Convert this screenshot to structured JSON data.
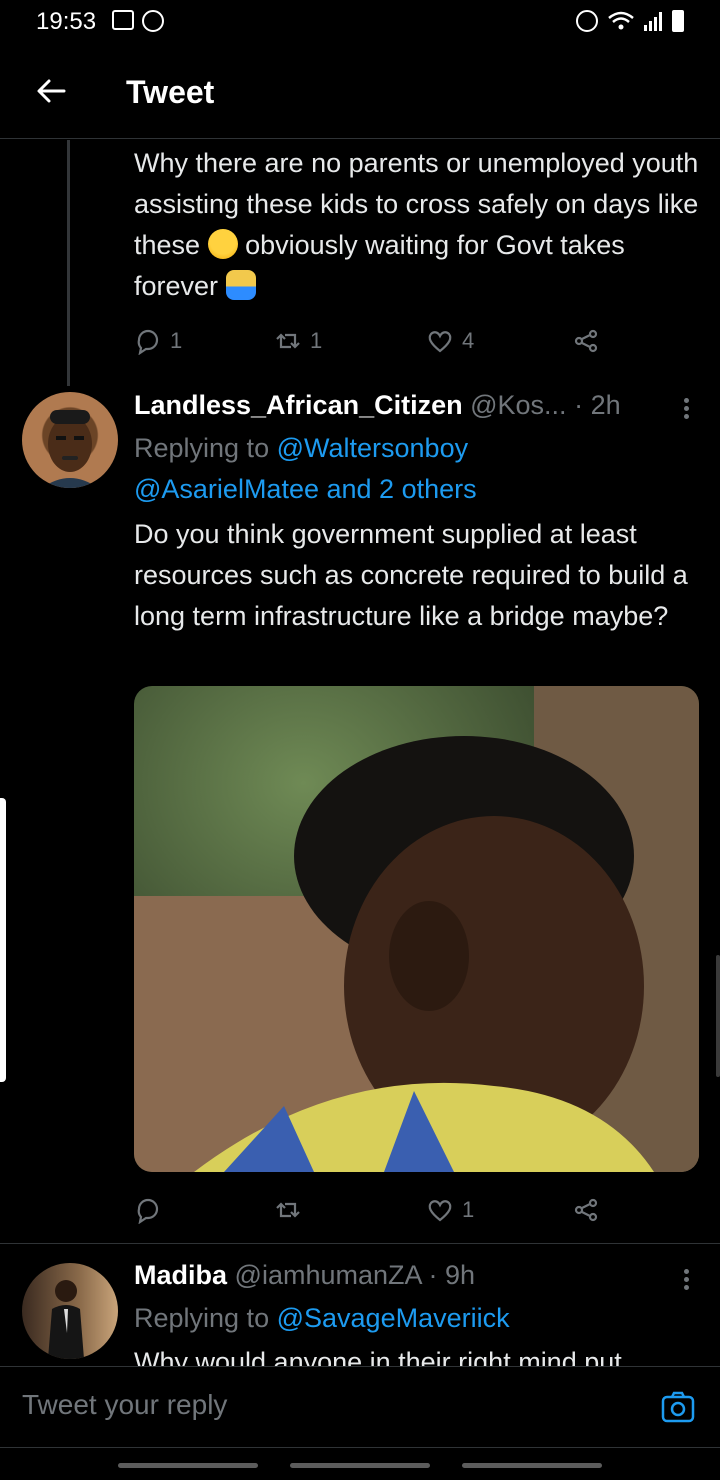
{
  "status_bar": {
    "time": "19:53"
  },
  "header": {
    "title": "Tweet"
  },
  "parent_tweet": {
    "text_parts": [
      "Why there are no parents or unemployed youth assisting these kids to cross safely on days like these",
      "obviously waiting for Govt takes forever"
    ],
    "emojis": [
      "loudly-crying-face",
      "man-facepalming"
    ],
    "replies": "1",
    "retweets": "1",
    "likes": "4"
  },
  "reply_tweet": {
    "name": "Landless_African_Citizen",
    "handle": "@Kos...",
    "time": "· 2h",
    "replying_prefix": "Replying to",
    "mention1": "@Waltersonboy",
    "mention2": "@AsarielMatee",
    "mention_suffix": "and 2 others",
    "text": "Do you think government supplied at least resources such as concrete required to build a long term infrastructure like a bridge maybe?",
    "likes": "1"
  },
  "third_tweet": {
    "name": "Madiba",
    "handle": "@iamhumanZA",
    "time": "· 9h",
    "replying_prefix": "Replying to",
    "mention": "@SavageMaveriick",
    "text_partial": "Why would anyone in their right mind put"
  },
  "reply_bar": {
    "placeholder": "Tweet your reply"
  },
  "colors": {
    "accent": "#1d9bf0",
    "muted": "#71767b",
    "background": "#000000"
  }
}
